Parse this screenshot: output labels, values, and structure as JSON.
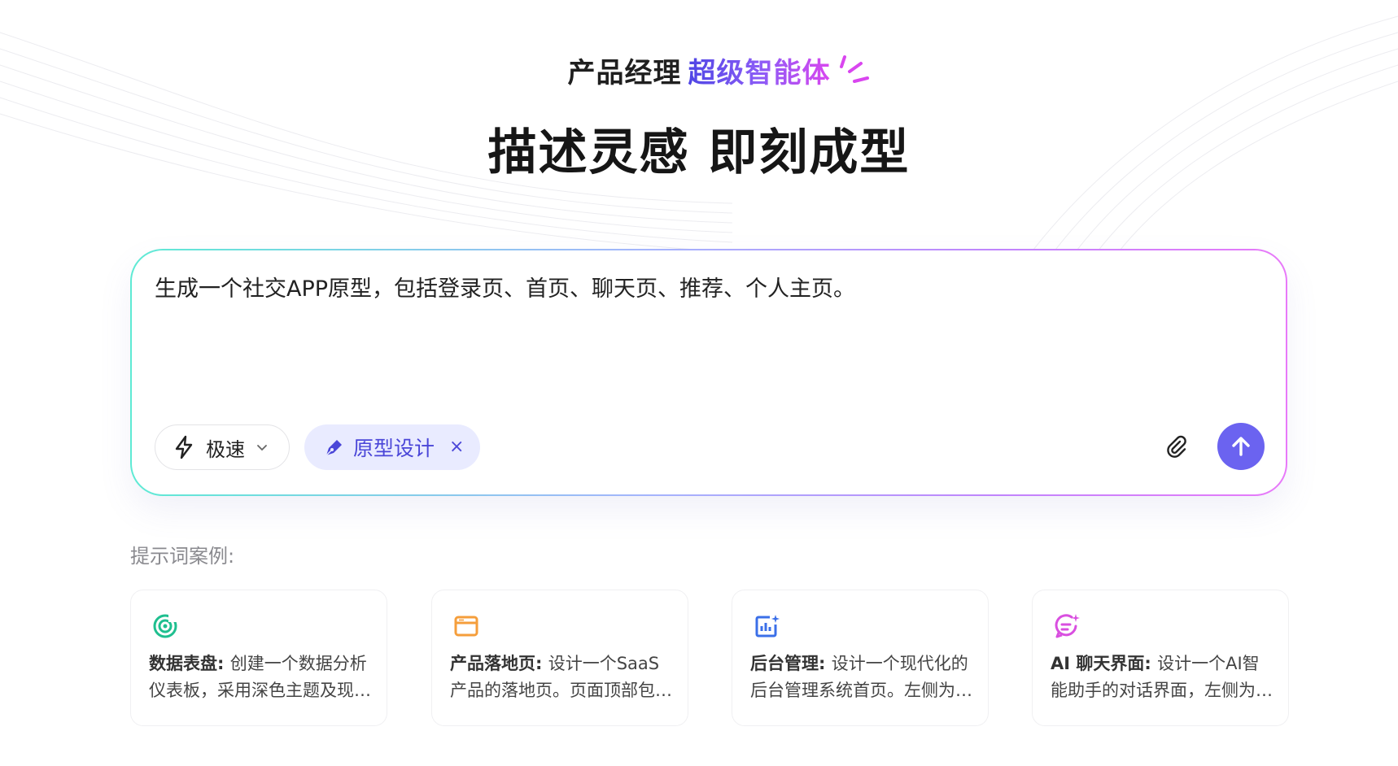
{
  "hero": {
    "subtitle_plain": "产品经理",
    "subtitle_accent": "超级智能体",
    "headline": "描述灵感 即刻成型"
  },
  "prompt": {
    "text": "生成一个社交APP原型，包括登录页、首页、聊天页、推荐、个人主页。",
    "mode_label": "极速",
    "tag_label": "原型设计",
    "tag_close": "×"
  },
  "examples": {
    "label": "提示词案例:",
    "cards": [
      {
        "title": "数据表盘",
        "sep": ": ",
        "desc": "创建一个数据分析仪表板，采用深色主题及现代化设计",
        "icon": "target-icon",
        "color": "#1fbf8f"
      },
      {
        "title": "产品落地页",
        "sep": ": ",
        "desc": "设计一个SaaS产品的落地页。页面顶部包含导航栏",
        "icon": "browser-window-icon",
        "color": "#f59e3b"
      },
      {
        "title": "后台管理",
        "sep": ": ",
        "desc": "设计一个现代化的后台管理系统首页。左侧为导航菜单",
        "icon": "chart-sparkle-icon",
        "color": "#3b6fe8"
      },
      {
        "title": "AI 聊天界面",
        "sep": ": ",
        "desc": "设计一个AI智能助手的对话界面，左侧为会话列表",
        "icon": "chat-sparkle-icon",
        "color": "#d94fe0"
      }
    ]
  },
  "colors": {
    "accent_primary": "#6b63f0",
    "chip_bg": "#e9ebff",
    "chip_text": "#4a46d8"
  }
}
